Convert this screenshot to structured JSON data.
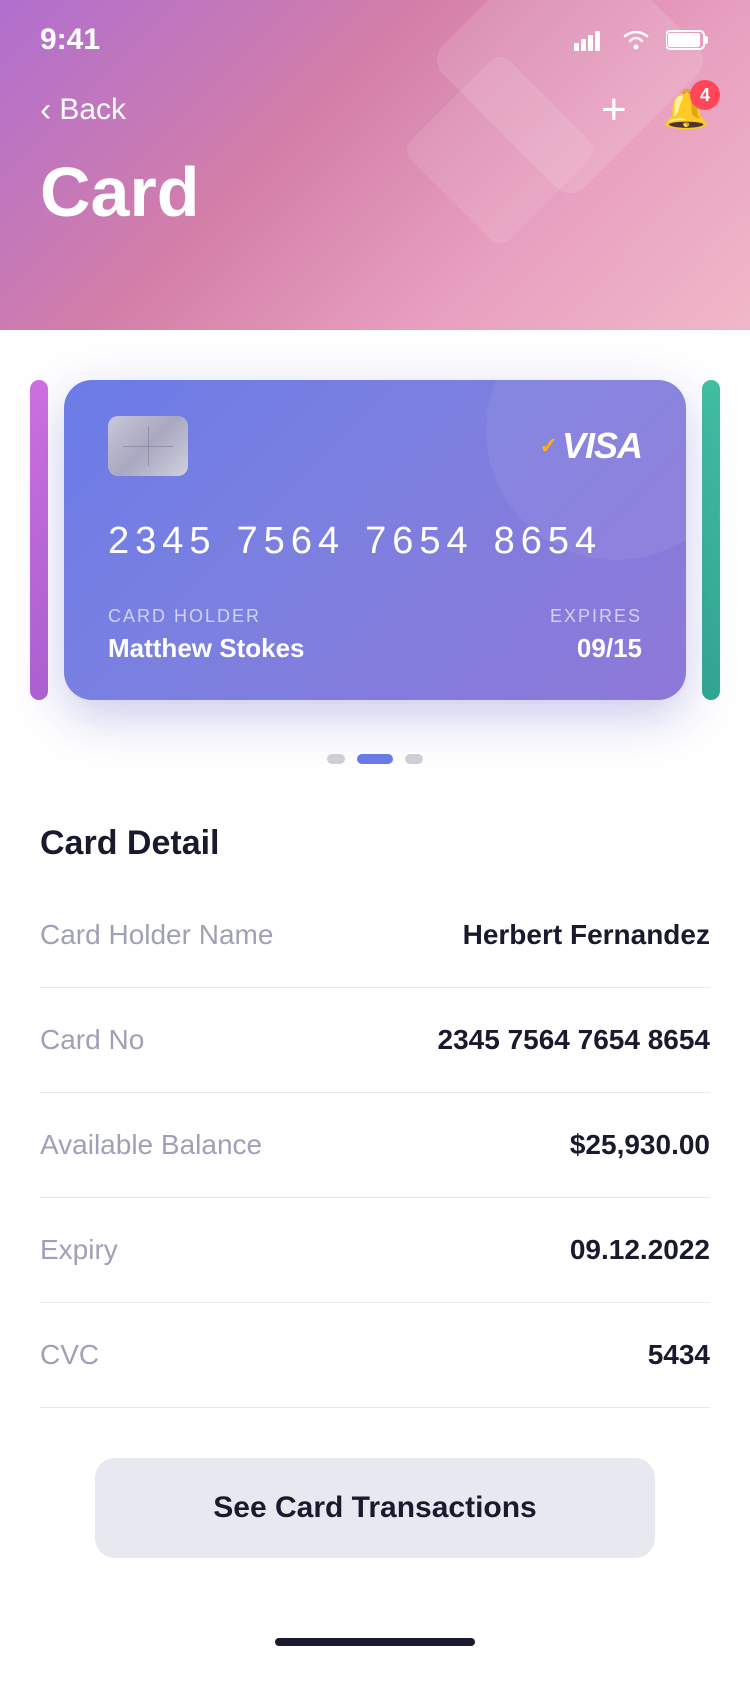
{
  "statusBar": {
    "time": "9:41",
    "notifCount": "4"
  },
  "header": {
    "backLabel": "Back",
    "pageTitle": "Card",
    "addLabel": "+",
    "notifBadge": "4"
  },
  "card": {
    "number1": "2345",
    "number2": "7564",
    "number3": "7654",
    "number4": "8654",
    "holderLabel": "CARD HOLDER",
    "holderName": "Matthew Stokes",
    "expiresLabel": "EXPIRES",
    "expiresValue": "09/15",
    "visaLabel": "VISA"
  },
  "cardDetail": {
    "sectionTitle": "Card Detail",
    "rows": [
      {
        "label": "Card Holder Name",
        "value": "Herbert Fernandez"
      },
      {
        "label": "Card No",
        "value": "2345 7564 7654 8654"
      },
      {
        "label": "Available Balance",
        "value": "$25,930.00"
      },
      {
        "label": "Expiry",
        "value": "09.12.2022"
      },
      {
        "label": "CVC",
        "value": "5434"
      }
    ]
  },
  "button": {
    "seeTransactions": "See Card Transactions"
  }
}
